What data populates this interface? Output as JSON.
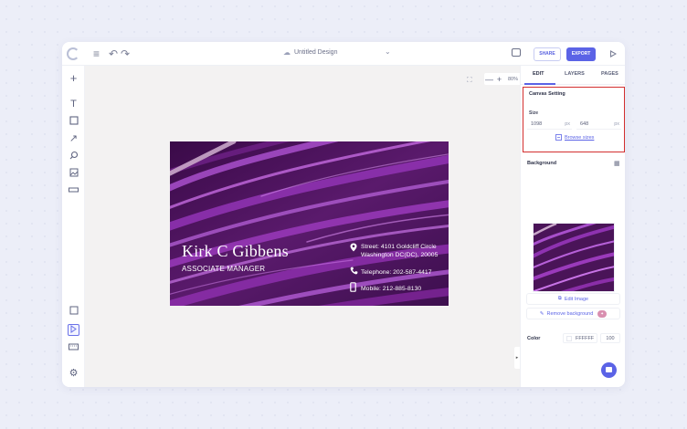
{
  "toolbar": {
    "menu_icon": "hamburger-icon",
    "undo_icon": "undo-icon",
    "redo_icon": "redo-icon",
    "document_title": "Untitled Design",
    "share_label": "SHARE",
    "export_label": "EXPORT"
  },
  "left_tools": [
    "add-icon",
    "text-icon",
    "shape-icon",
    "arrow-icon",
    "search-icon",
    "image-icon",
    "ruler-icon",
    "frame-icon",
    "cursor-icon",
    "keyboard-icon",
    "settings-icon"
  ],
  "canvas": {
    "zoom_minus": "—",
    "zoom_plus": "+",
    "zoom_value": "80%",
    "background_color": "#f3f2f2"
  },
  "card": {
    "name": "Kirk C Gibbens",
    "role": "ASSOCIATE MANAGER",
    "street": "Street: 4101 Goldcliff Circle",
    "city": "Washington DC(DC), 20005",
    "telephone": "Telephone: 202-587-4417",
    "mobile": "Mobile: 212-885-8130",
    "primary_color": "#4a1458",
    "accent_color": "#a64bc4"
  },
  "panel": {
    "tabs": [
      "EDIT",
      "LAYERS",
      "PAGES"
    ],
    "active_tab": "EDIT",
    "canvas_setting_title": "Canvas Setting",
    "size_label": "Size",
    "width_value": "1098",
    "height_value": "648",
    "unit": "px",
    "browse_sizes": "Browse sizes",
    "background_title": "Background",
    "edit_image": "Edit Image",
    "remove_background": "Remove background",
    "color_label": "Color",
    "color_value": "FFFFFF",
    "opacity_value": "100",
    "accent": "#5b63e6",
    "highlight_border": "#d32f2f"
  }
}
